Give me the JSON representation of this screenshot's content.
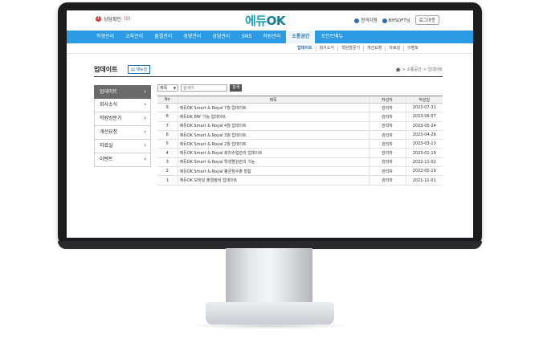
{
  "header": {
    "alert_text": "상담확인",
    "alert_count": "(0)",
    "logo_main": "에듀",
    "logo_ok": "OK",
    "support_label": "원격지원",
    "user_label": "BHSOFT님",
    "logout_label": "로그아웃"
  },
  "nav": {
    "items": [
      "학생관리",
      "교육관리",
      "출결관리",
      "경영관리",
      "상담관리",
      "SMS",
      "학원관리",
      "소통공간",
      "포인트메뉴"
    ],
    "active_index": 7
  },
  "subnav": {
    "items": [
      "업데이트",
      "회사소식",
      "학원방문기",
      "개선요청",
      "자료실",
      "이벤트"
    ],
    "active_index": 0
  },
  "page": {
    "title": "업데이트",
    "manual_label": "매뉴얼",
    "breadcrumb": [
      "> 소통공간",
      "> 업데이트"
    ]
  },
  "side_menu": {
    "items": [
      "업데이트",
      "회사소식",
      "학원방문기",
      "개선요청",
      "자료실",
      "이벤트"
    ],
    "active_index": 0
  },
  "search": {
    "select_value": "제목",
    "placeholder": "검색어",
    "button_label": "검색"
  },
  "table": {
    "headers": [
      "No",
      "제목",
      "작성자",
      "작성일"
    ],
    "rows": [
      [
        "9",
        "에듀OK Smart & Royal 7월 업데이트",
        "관리자",
        "2023-07-31"
      ],
      [
        "8",
        "에듀OK PAY 기능 업데이트",
        "관리자",
        "2023-06-07"
      ],
      [
        "7",
        "에듀OK Smart & Royal 4월 업데이트",
        "관리자",
        "2023-05-24"
      ],
      [
        "6",
        "에듀OK Smart & Royal 3월 업데이트",
        "관리자",
        "2023-04-26"
      ],
      [
        "5",
        "에듀OK Smart & Royal 2월 업데이트",
        "관리자",
        "2023-03-13"
      ],
      [
        "4",
        "에듀OK Smart & Royal 회차수업관리 업데이트",
        "관리자",
        "2023-01-19"
      ],
      [
        "3",
        "에듀OK Smart & Royal 학생별강관리 기능",
        "관리자",
        "2022-11-02"
      ],
      [
        "2",
        "에듀OK Smart & Royal 평균점수출 발합",
        "관리자",
        "2022-05-19"
      ],
      [
        "1",
        "에듀OK 모바일 출결정비 업데이트",
        "관리자",
        "2021-11-01"
      ]
    ]
  }
}
